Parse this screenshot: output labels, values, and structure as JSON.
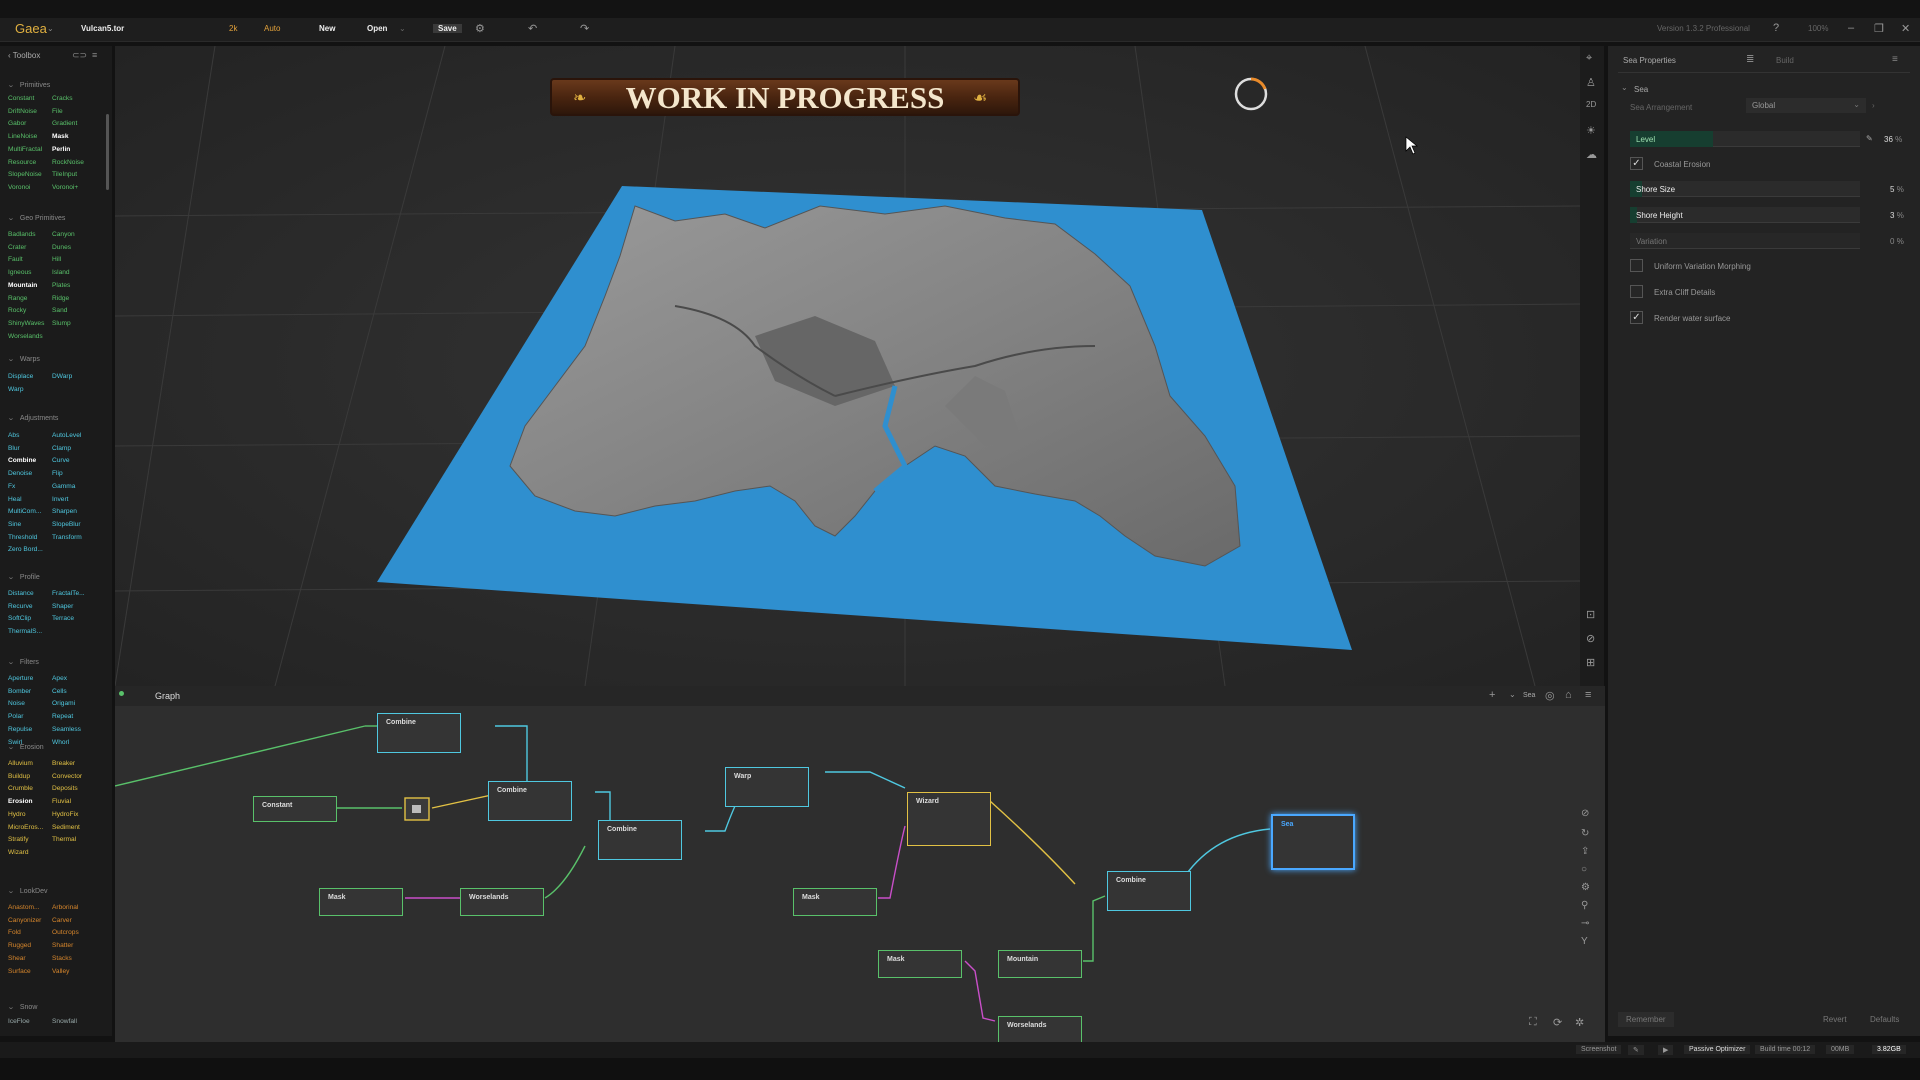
{
  "topbar": {
    "brand": "Gaea",
    "filename": "Vulcan5.tor",
    "resolution": "2k",
    "mode": "Auto",
    "new_label": "New",
    "open_label": "Open",
    "save_label": "Save",
    "version": "Version 1.3.2 Professional",
    "zoom": "100%"
  },
  "toolbox": {
    "title": "Toolbox",
    "sections": [
      {
        "title": "Primitives",
        "nodes": [
          [
            "Constant",
            "Cracks"
          ],
          [
            "DriftNoise",
            "File"
          ],
          [
            "Gabor",
            "Gradient"
          ],
          [
            "LineNoise",
            "Mask"
          ],
          [
            "MultiFractal",
            "Perlin"
          ],
          [
            "Resource",
            "RockNoise"
          ],
          [
            "SlopeNoise",
            "TileInput"
          ],
          [
            "Voronoi",
            "Voronoi+"
          ]
        ]
      },
      {
        "title": "Geo Primitives",
        "nodes": [
          [
            "Badlands",
            "Canyon"
          ],
          [
            "Crater",
            "Dunes"
          ],
          [
            "Fault",
            "Hill"
          ],
          [
            "Igneous",
            "Island"
          ],
          [
            "Mountain",
            "Plates"
          ],
          [
            "Range",
            "Ridge"
          ],
          [
            "Rocky",
            "Sand"
          ],
          [
            "ShinyWaves",
            "Slump"
          ],
          [
            "Worselands",
            ""
          ]
        ]
      },
      {
        "title": "Warps",
        "nodes": [
          [
            "Displace",
            "DWarp"
          ],
          [
            "Warp",
            ""
          ]
        ]
      },
      {
        "title": "Adjustments",
        "nodes": [
          [
            "Abs",
            "AutoLevel"
          ],
          [
            "Blur",
            "Clamp"
          ],
          [
            "Combine",
            "Curve"
          ],
          [
            "Denoise",
            "Flip"
          ],
          [
            "Fx",
            "Gamma"
          ],
          [
            "Heal",
            "Invert"
          ],
          [
            "MultiCom...",
            "Sharpen"
          ],
          [
            "Sine",
            "SlopeBlur"
          ],
          [
            "Threshold",
            "Transform"
          ],
          [
            "Zero Bord...",
            ""
          ]
        ]
      },
      {
        "title": "Profile",
        "nodes": [
          [
            "Distance",
            "FractalTe..."
          ],
          [
            "Recurve",
            "Shaper"
          ],
          [
            "SoftClip",
            "Terrace"
          ],
          [
            "ThermalS...",
            ""
          ]
        ]
      },
      {
        "title": "Filters",
        "nodes": [
          [
            "Aperture",
            "Apex"
          ],
          [
            "Bomber",
            "Cells"
          ],
          [
            "Noise",
            "Origami"
          ],
          [
            "Polar",
            "Repeat"
          ],
          [
            "Repulse",
            "Seamless"
          ],
          [
            "Swirl",
            "Whorl"
          ]
        ]
      },
      {
        "title": "Erosion",
        "nodes": [
          [
            "Alluvium",
            "Breaker"
          ],
          [
            "Buildup",
            "Convector"
          ],
          [
            "Crumble",
            "Deposits"
          ],
          [
            "Erosion",
            "Fluvial"
          ],
          [
            "Hydro",
            "HydroFix"
          ],
          [
            "MicroEros...",
            "Sediment"
          ],
          [
            "Stratify",
            "Thermal"
          ],
          [
            "Wizard",
            ""
          ]
        ]
      },
      {
        "title": "LookDev",
        "nodes": [
          [
            "Anastom...",
            "Arborinal"
          ],
          [
            "Canyonizer",
            "Carver"
          ],
          [
            "Fold",
            "Outcrops"
          ],
          [
            "Rugged",
            "Shatter"
          ],
          [
            "Shear",
            "Stacks"
          ],
          [
            "Surface",
            "Valley"
          ]
        ]
      },
      {
        "title": "Snow",
        "nodes": [
          [
            "IceFloe",
            "Snowfall"
          ]
        ]
      }
    ]
  },
  "viewport": {
    "banner": "WORK IN PROGRESS",
    "strip_2d": "2D"
  },
  "graph": {
    "tab": "Graph",
    "selected_node": "Sea",
    "nodes": [
      {
        "id": "combine1",
        "label": "Combine"
      },
      {
        "id": "constant",
        "label": "Constant"
      },
      {
        "id": "combine2",
        "label": "Combine"
      },
      {
        "id": "combine3",
        "label": "Combine"
      },
      {
        "id": "warp",
        "label": "Warp"
      },
      {
        "id": "wizard",
        "label": "Wizard"
      },
      {
        "id": "sea",
        "label": "Sea"
      },
      {
        "id": "mask1",
        "label": "Mask"
      },
      {
        "id": "worselands1",
        "label": "Worselands"
      },
      {
        "id": "mask2",
        "label": "Mask"
      },
      {
        "id": "combine4",
        "label": "Combine"
      },
      {
        "id": "mask3",
        "label": "Mask"
      },
      {
        "id": "mountain",
        "label": "Mountain"
      },
      {
        "id": "worselands2",
        "label": "Worselands"
      }
    ]
  },
  "properties": {
    "title": "Sea Properties",
    "build_tab": "Build",
    "section": "Sea",
    "arrangement_label": "Sea Arrangement",
    "arrangement_value": "Global",
    "level": {
      "label": "Level",
      "value": "36",
      "unit": "%",
      "fraction": 0.36
    },
    "coastal_erosion": {
      "label": "Coastal Erosion",
      "checked": true
    },
    "shore_size": {
      "label": "Shore Size",
      "value": "5",
      "unit": "%",
      "fraction": 0.05
    },
    "shore_height": {
      "label": "Shore Height",
      "value": "3",
      "unit": "%",
      "fraction": 0.03
    },
    "variation": {
      "label": "Variation",
      "value": "0",
      "unit": "%"
    },
    "uniform_variation": {
      "label": "Uniform Variation Morphing",
      "checked": false
    },
    "extra_cliff": {
      "label": "Extra Cliff Details",
      "checked": false
    },
    "render_water": {
      "label": "Render water surface",
      "checked": true
    },
    "remember_label": "Remember",
    "revert_label": "Revert",
    "defaults_label": "Defaults"
  },
  "status": {
    "screenshot": "Screenshot",
    "passive": "Passive Optimizer",
    "build_time": "Build time 00:12",
    "mem1": "00MB",
    "mem2": "3.82GB"
  },
  "colors": {
    "accent_green": "#59c16a",
    "accent_cyan": "#4fc8e0",
    "accent_orange": "#d6862c",
    "accent_yellow": "#e2c144",
    "sea_blue": "#2f8fcf",
    "selection": "#4aa8ff"
  }
}
